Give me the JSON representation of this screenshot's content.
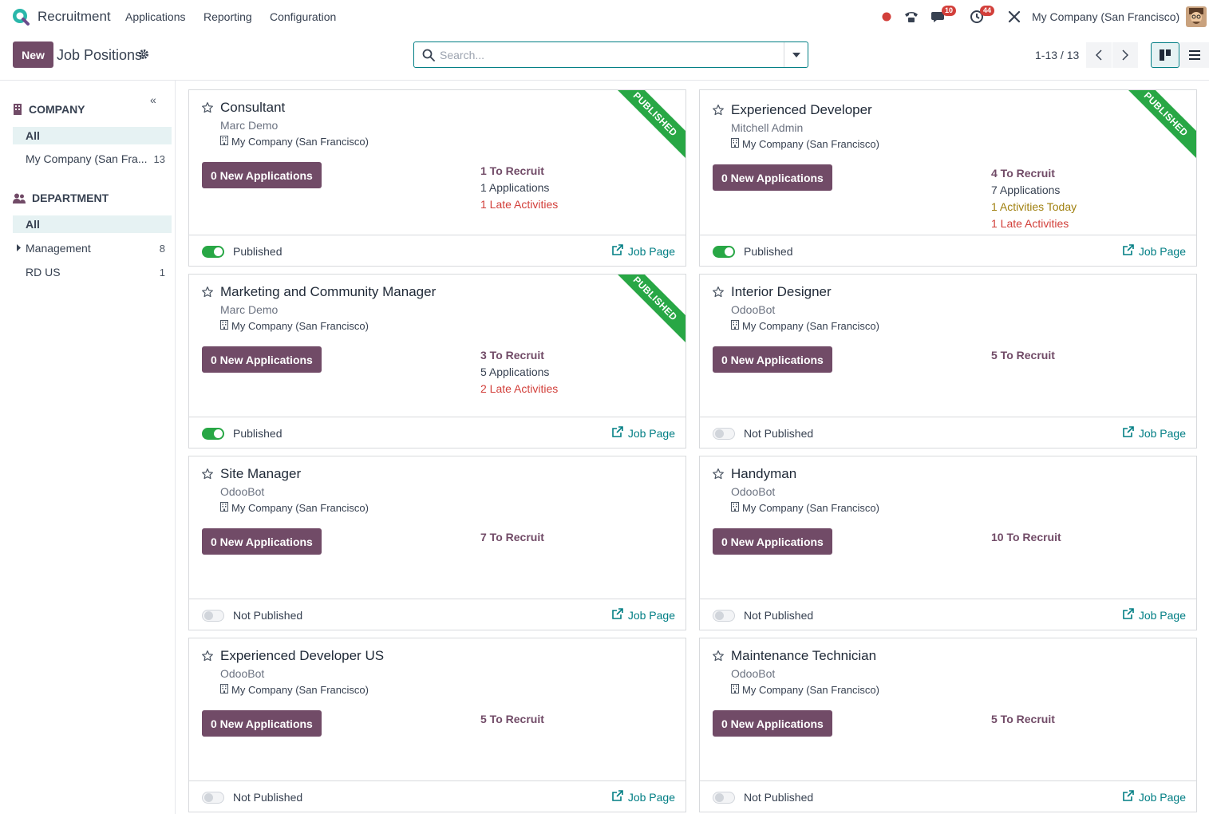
{
  "nav": {
    "app_name": "Recruitment",
    "menus": [
      "Applications",
      "Reporting",
      "Configuration"
    ],
    "chat_badge": "10",
    "activity_badge": "44",
    "company": "My Company (San Francisco)"
  },
  "control": {
    "new_label": "New",
    "title": "Job Positions",
    "search_placeholder": "Search...",
    "pager": "1-13 / 13"
  },
  "sidebar": {
    "company_head": "COMPANY",
    "company_items": [
      {
        "label": "All",
        "count": ""
      },
      {
        "label": "My Company (San Fra...",
        "count": "13"
      }
    ],
    "dept_head": "DEPARTMENT",
    "dept_items": [
      {
        "label": "All",
        "count": ""
      },
      {
        "label": "Management",
        "count": "8"
      },
      {
        "label": "RD US",
        "count": "1"
      }
    ]
  },
  "cards": [
    {
      "title": "Consultant",
      "recruiter": "Marc Demo",
      "company": "My Company (San Francisco)",
      "apps_btn": "0 New Applications",
      "stats": [
        {
          "text": "1 To Recruit",
          "kind": "bold"
        },
        {
          "text": "1 Applications",
          "kind": "normal"
        },
        {
          "text": "1 Late Activities",
          "kind": "late"
        }
      ],
      "status": "Published",
      "published": true,
      "ribbon": "PUBLISHED",
      "job_page": "Job Page"
    },
    {
      "title": "Experienced Developer",
      "recruiter": "Mitchell Admin",
      "company": "My Company (San Francisco)",
      "apps_btn": "0 New Applications",
      "stats": [
        {
          "text": "4 To Recruit",
          "kind": "bold"
        },
        {
          "text": "7 Applications",
          "kind": "normal"
        },
        {
          "text": "1 Activities Today",
          "kind": "today"
        },
        {
          "text": "1 Late Activities",
          "kind": "late"
        }
      ],
      "status": "Published",
      "published": true,
      "ribbon": "PUBLISHED",
      "job_page": "Job Page"
    },
    {
      "title": "Marketing and Community Manager",
      "recruiter": "Marc Demo",
      "company": "My Company (San Francisco)",
      "apps_btn": "0 New Applications",
      "stats": [
        {
          "text": "3 To Recruit",
          "kind": "bold"
        },
        {
          "text": "5 Applications",
          "kind": "normal"
        },
        {
          "text": "2 Late Activities",
          "kind": "late"
        }
      ],
      "status": "Published",
      "published": true,
      "ribbon": "PUBLISHED",
      "job_page": "Job Page"
    },
    {
      "title": "Interior Designer",
      "recruiter": "OdooBot",
      "company": "My Company (San Francisco)",
      "apps_btn": "0 New Applications",
      "stats": [
        {
          "text": "5 To Recruit",
          "kind": "bold"
        }
      ],
      "status": "Not Published",
      "published": false,
      "ribbon": "",
      "job_page": "Job Page"
    },
    {
      "title": "Site Manager",
      "recruiter": "OdooBot",
      "company": "My Company (San Francisco)",
      "apps_btn": "0 New Applications",
      "stats": [
        {
          "text": "7 To Recruit",
          "kind": "bold"
        }
      ],
      "status": "Not Published",
      "published": false,
      "ribbon": "",
      "job_page": "Job Page"
    },
    {
      "title": "Handyman",
      "recruiter": "OdooBot",
      "company": "My Company (San Francisco)",
      "apps_btn": "0 New Applications",
      "stats": [
        {
          "text": "10 To Recruit",
          "kind": "bold"
        }
      ],
      "status": "Not Published",
      "published": false,
      "ribbon": "",
      "job_page": "Job Page"
    },
    {
      "title": "Experienced Developer US",
      "recruiter": "OdooBot",
      "company": "My Company (San Francisco)",
      "apps_btn": "0 New Applications",
      "stats": [
        {
          "text": "5 To Recruit",
          "kind": "bold"
        }
      ],
      "status": "Not Published",
      "published": false,
      "ribbon": "",
      "job_page": "Job Page"
    },
    {
      "title": "Maintenance Technician",
      "recruiter": "OdooBot",
      "company": "My Company (San Francisco)",
      "apps_btn": "0 New Applications",
      "stats": [
        {
          "text": "5 To Recruit",
          "kind": "bold"
        }
      ],
      "status": "Not Published",
      "published": false,
      "ribbon": "",
      "job_page": "Job Page"
    }
  ]
}
